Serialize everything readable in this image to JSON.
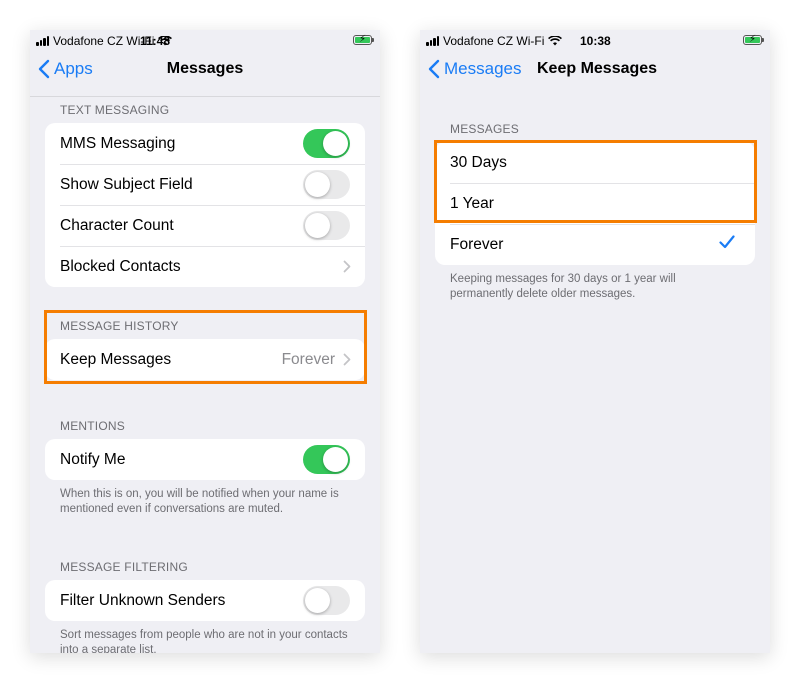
{
  "colors": {
    "accent": "#1a7cf5",
    "toggle_on": "#34c759",
    "highlight": "#f57d00"
  },
  "left_screen": {
    "status": {
      "carrier": "Vodafone CZ Wi-Fi",
      "time": "11:48",
      "wifi_icon": "wifi-icon",
      "battery_icon": "battery-charging-icon"
    },
    "nav": {
      "back_label": "Apps",
      "title": "Messages"
    },
    "text_messaging": {
      "header": "TEXT MESSAGING",
      "rows": [
        {
          "label": "MMS Messaging",
          "toggle": true
        },
        {
          "label": "Show Subject Field",
          "toggle": false
        },
        {
          "label": "Character Count",
          "toggle": false
        },
        {
          "label": "Blocked Contacts"
        }
      ]
    },
    "message_history": {
      "header": "MESSAGE HISTORY",
      "keep_label": "Keep Messages",
      "keep_value": "Forever"
    },
    "mentions": {
      "header": "MENTIONS",
      "notify_label": "Notify Me",
      "notify_on": true,
      "footer": "When this is on, you will be notified when your name is mentioned even if conversations are muted."
    },
    "message_filtering": {
      "header": "MESSAGE FILTERING",
      "filter_label": "Filter Unknown Senders",
      "filter_on": false,
      "footer": "Sort messages from people who are not in your contacts into a separate list."
    }
  },
  "right_screen": {
    "status": {
      "carrier": "Vodafone CZ Wi-Fi",
      "time": "10:38",
      "wifi_icon": "wifi-icon",
      "battery_icon": "battery-charging-icon"
    },
    "nav": {
      "back_label": "Messages",
      "title": "Keep Messages"
    },
    "messages": {
      "header": "MESSAGES",
      "options": [
        {
          "label": "30 Days",
          "selected": false
        },
        {
          "label": "1 Year",
          "selected": false
        },
        {
          "label": "Forever",
          "selected": true
        }
      ],
      "footer": "Keeping messages for 30 days or 1 year will permanently delete older messages."
    }
  }
}
